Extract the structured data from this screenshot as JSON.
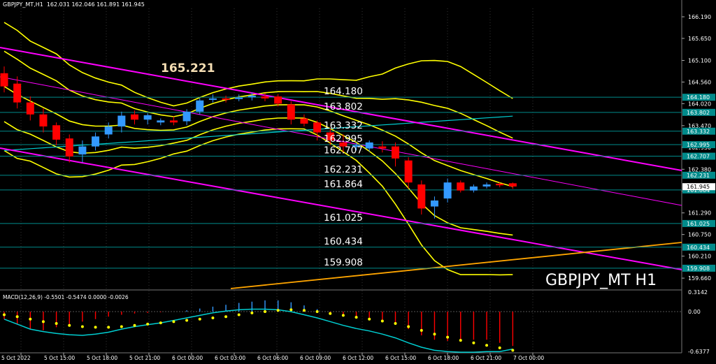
{
  "header": {
    "symbol": "GBPJPY_MT,H1",
    "ohlc": "162.031 162.046 161.891 161.945"
  },
  "watermark": "GBPJPY_MT H1",
  "colors": {
    "background": "#000000",
    "bull": "#3399FF",
    "bear": "#FF0000",
    "bollinger": "#FFFF00",
    "channel": "#FF00FF",
    "hline": "#008B8B",
    "ma_cyan": "#00CED1",
    "trend_up": "#FFA500",
    "macd_signal": "#FFFF00",
    "macd_line": "#00CED1"
  },
  "chart_data": {
    "type": "candlestick",
    "title": "GBPJPY_MT,H1",
    "ylim": [
      159.4,
      166.4
    ],
    "price_ticks": [
      "166.190",
      "165.650",
      "165.100",
      "164.560",
      "164.020",
      "163.470",
      "162.930",
      "162.380",
      "161.835",
      "161.290",
      "160.750",
      "160.210",
      "159.660"
    ],
    "time_ticks": [
      "5 Oct 2022",
      "5 Oct 15:00",
      "5 Oct 18:00",
      "5 Oct 21:00",
      "6 Oct 00:00",
      "6 Oct 03:00",
      "6 Oct 06:00",
      "6 Oct 09:00",
      "6 Oct 12:00",
      "6 Oct 15:00",
      "6 Oct 18:00",
      "6 Oct 21:00",
      "7 Oct 00:00"
    ],
    "candles": [
      {
        "o": 164.78,
        "h": 164.95,
        "c": 164.45,
        "l": 164.3
      },
      {
        "o": 164.52,
        "h": 164.7,
        "c": 164.05,
        "l": 163.9
      },
      {
        "o": 164.05,
        "h": 164.2,
        "c": 163.75,
        "l": 163.6
      },
      {
        "o": 163.75,
        "h": 163.9,
        "c": 163.45,
        "l": 163.3
      },
      {
        "o": 163.48,
        "h": 163.55,
        "c": 163.12,
        "l": 162.98
      },
      {
        "o": 163.15,
        "h": 163.25,
        "c": 162.7,
        "l": 162.55
      },
      {
        "o": 162.75,
        "h": 163.1,
        "c": 162.95,
        "l": 162.55
      },
      {
        "o": 162.95,
        "h": 163.3,
        "c": 163.2,
        "l": 162.85
      },
      {
        "o": 163.25,
        "h": 163.55,
        "c": 163.45,
        "l": 163.15
      },
      {
        "o": 163.45,
        "h": 163.82,
        "c": 163.72,
        "l": 163.3
      },
      {
        "o": 163.75,
        "h": 163.85,
        "c": 163.62,
        "l": 163.5
      },
      {
        "o": 163.62,
        "h": 163.78,
        "c": 163.73,
        "l": 163.5
      },
      {
        "o": 163.55,
        "h": 163.65,
        "c": 163.6,
        "l": 163.48
      },
      {
        "o": 163.6,
        "h": 163.7,
        "c": 163.55,
        "l": 163.48
      },
      {
        "o": 163.58,
        "h": 163.88,
        "c": 163.82,
        "l": 163.48
      },
      {
        "o": 163.82,
        "h": 164.15,
        "c": 164.1,
        "l": 163.75
      },
      {
        "o": 164.13,
        "h": 164.25,
        "c": 164.15,
        "l": 164.05
      },
      {
        "o": 164.15,
        "h": 164.22,
        "c": 164.12,
        "l": 164.05
      },
      {
        "o": 164.14,
        "h": 164.25,
        "c": 164.17,
        "l": 164.08
      },
      {
        "o": 164.18,
        "h": 164.3,
        "c": 164.22,
        "l": 164.1
      },
      {
        "o": 164.2,
        "h": 164.28,
        "c": 164.15,
        "l": 164.08
      },
      {
        "o": 164.2,
        "h": 164.26,
        "c": 164.02,
        "l": 163.95
      },
      {
        "o": 164.0,
        "h": 164.08,
        "c": 163.62,
        "l": 163.5
      },
      {
        "o": 163.65,
        "h": 163.75,
        "c": 163.52,
        "l": 163.45
      },
      {
        "o": 163.55,
        "h": 163.6,
        "c": 163.3,
        "l": 163.1
      },
      {
        "o": 163.3,
        "h": 163.42,
        "c": 163.1,
        "l": 162.98
      },
      {
        "o": 163.05,
        "h": 163.25,
        "c": 162.95,
        "l": 162.8
      },
      {
        "o": 162.95,
        "h": 163.05,
        "c": 162.98,
        "l": 162.85
      },
      {
        "o": 162.9,
        "h": 163.1,
        "c": 163.05,
        "l": 162.82
      },
      {
        "o": 162.95,
        "h": 163.08,
        "c": 162.9,
        "l": 162.8
      },
      {
        "o": 162.95,
        "h": 163.05,
        "c": 162.65,
        "l": 162.45
      },
      {
        "o": 162.6,
        "h": 162.68,
        "c": 162.05,
        "l": 161.9
      },
      {
        "o": 162.0,
        "h": 162.1,
        "c": 161.4,
        "l": 161.25
      },
      {
        "o": 161.45,
        "h": 161.7,
        "c": 161.6,
        "l": 161.15
      },
      {
        "o": 161.65,
        "h": 162.15,
        "c": 162.05,
        "l": 161.55
      },
      {
        "o": 162.05,
        "h": 162.1,
        "c": 161.85,
        "l": 161.8
      },
      {
        "o": 161.85,
        "h": 162.0,
        "c": 161.95,
        "l": 161.8
      },
      {
        "o": 161.95,
        "h": 162.05,
        "c": 162.0,
        "l": 161.9
      },
      {
        "o": 162.02,
        "h": 162.05,
        "c": 161.98,
        "l": 161.93
      },
      {
        "o": 162.03,
        "h": 162.05,
        "c": 161.95,
        "l": 161.89
      }
    ],
    "levels": [
      {
        "value": 164.18,
        "label": "164.180",
        "axis_label": "164.180"
      },
      {
        "value": 163.802,
        "label": "163.802",
        "axis_label": "163.802"
      },
      {
        "value": 163.332,
        "label": "163.332",
        "axis_label": "163.332"
      },
      {
        "value": 162.995,
        "label": "162.995",
        "axis_label": "162.995"
      },
      {
        "value": 162.707,
        "label": "162.707",
        "axis_label": "162.707"
      },
      {
        "value": 162.231,
        "label": "162.231",
        "axis_label": "162.231"
      },
      {
        "value": 161.864,
        "label": "161.864",
        "axis_label": "161.864"
      },
      {
        "value": 161.025,
        "label": "161.025",
        "axis_label": "161.025"
      },
      {
        "value": 160.434,
        "label": "160.434",
        "axis_label": "160.434"
      },
      {
        "value": 159.908,
        "label": "159.908",
        "axis_label": "159.908"
      }
    ],
    "high_annotation": {
      "value": 165.221,
      "label": "165.221"
    },
    "current_price": {
      "value": 161.945,
      "label": "161.945"
    },
    "macd": {
      "label": "MACD(12,26,9) -0.5501 -0.5474 0.0000 -0.0026",
      "ticks": [
        "0.3142",
        "0.00",
        "-0.6377"
      ],
      "histogram": [
        -0.12,
        -0.2,
        -0.28,
        -0.3,
        -0.25,
        -0.2,
        -0.16,
        -0.12,
        -0.08,
        -0.05,
        -0.03,
        -0.02,
        -0.01,
        0.0,
        0.02,
        0.05,
        0.08,
        0.11,
        0.14,
        0.16,
        0.18,
        0.18,
        0.15,
        0.1,
        0.04,
        -0.02,
        -0.06,
        -0.1,
        -0.12,
        -0.15,
        -0.2,
        -0.28,
        -0.38,
        -0.45,
        -0.47,
        -0.48,
        -0.45,
        -0.45,
        -0.5,
        -0.55
      ],
      "signal": [
        -0.05,
        -0.08,
        -0.12,
        -0.16,
        -0.19,
        -0.22,
        -0.24,
        -0.25,
        -0.25,
        -0.24,
        -0.22,
        -0.2,
        -0.18,
        -0.16,
        -0.14,
        -0.12,
        -0.1,
        -0.08,
        -0.05,
        -0.02,
        0.0,
        0.02,
        0.03,
        0.02,
        0.0,
        -0.03,
        -0.06,
        -0.09,
        -0.12,
        -0.15,
        -0.19,
        -0.24,
        -0.3,
        -0.36,
        -0.41,
        -0.46,
        -0.5,
        -0.54,
        -0.58,
        -0.62
      ],
      "macd_line": [
        -0.12,
        -0.2,
        -0.28,
        -0.32,
        -0.35,
        -0.37,
        -0.38,
        -0.36,
        -0.33,
        -0.28,
        -0.24,
        -0.21,
        -0.18,
        -0.14,
        -0.1,
        -0.06,
        -0.02,
        0.01,
        0.03,
        0.04,
        0.04,
        0.03,
        0.0,
        -0.05,
        -0.1,
        -0.16,
        -0.22,
        -0.27,
        -0.31,
        -0.36,
        -0.42,
        -0.5,
        -0.57,
        -0.62,
        -0.64,
        -0.65,
        -0.65,
        -0.64,
        -0.64,
        -0.6
      ]
    }
  }
}
